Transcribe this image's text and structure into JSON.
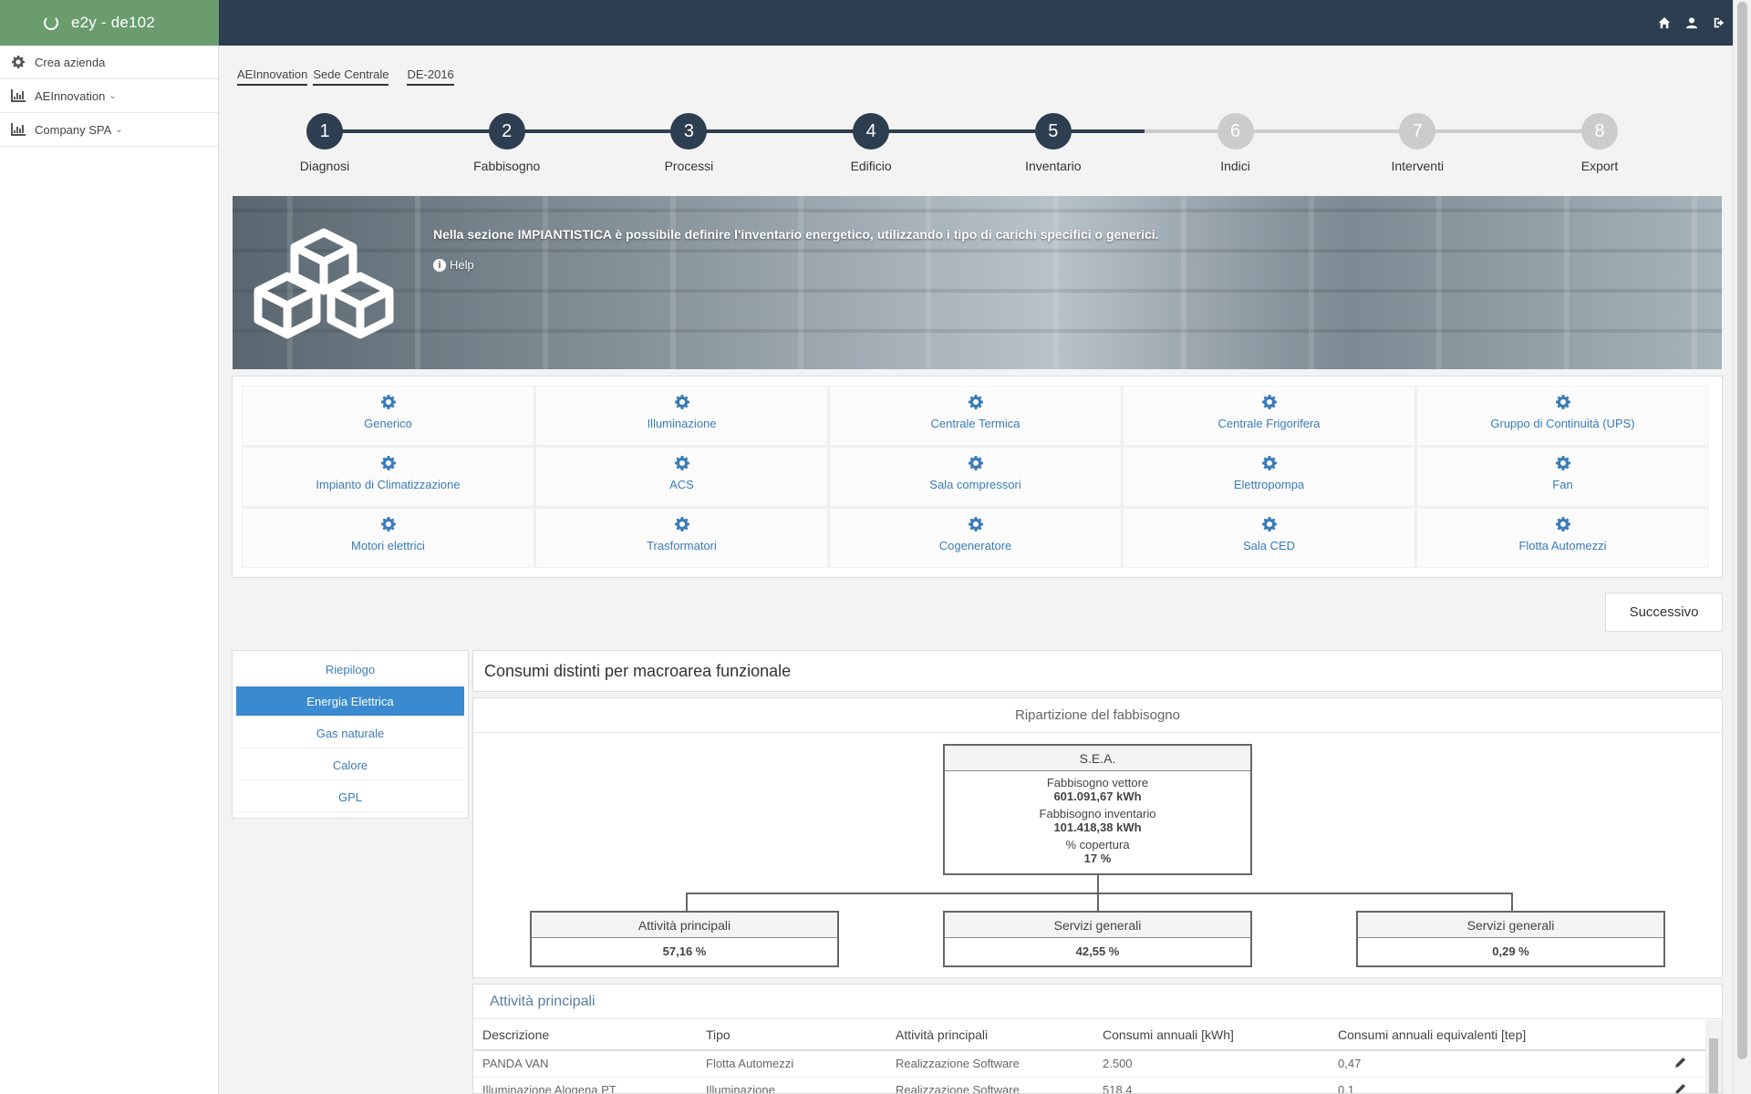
{
  "app": {
    "title": "e2y - de102"
  },
  "sidebar": {
    "items": [
      {
        "label": "Crea azienda",
        "icon": "gear-icon",
        "has_dropdown": false
      },
      {
        "label": "AEInnovation",
        "icon": "bar-chart-icon",
        "has_dropdown": true
      },
      {
        "label": "Company SPA",
        "icon": "bar-chart-icon",
        "has_dropdown": true
      }
    ]
  },
  "topbar": {
    "icons": [
      "home-icon",
      "user-icon",
      "logout-icon"
    ]
  },
  "breadcrumb": [
    "AEInnovation",
    "Sede Centrale",
    "DE-2016"
  ],
  "steps": [
    {
      "number": "1",
      "label": "Diagnosi",
      "done": true
    },
    {
      "number": "2",
      "label": "Fabbisogno",
      "done": true
    },
    {
      "number": "3",
      "label": "Processi",
      "done": true
    },
    {
      "number": "4",
      "label": "Edificio",
      "done": true
    },
    {
      "number": "5",
      "label": "Inventario",
      "done": true
    },
    {
      "number": "6",
      "label": "Indici",
      "done": false
    },
    {
      "number": "7",
      "label": "Interventi",
      "done": false
    },
    {
      "number": "8",
      "label": "Export",
      "done": false
    }
  ],
  "banner": {
    "message": "Nella sezione IMPIANTISTICA è possibile definire l'inventario energetico, utilizzando i tipo di carichi specifici o generici.",
    "help_label": "Help"
  },
  "categories": [
    "Generico",
    "Illuminazione",
    "Centrale Termica",
    "Centrale Frigorifera",
    "Gruppo di Continuità (UPS)",
    "Impianto di Climatizzazione",
    "ACS",
    "Sala compressori",
    "Elettropompa",
    "Fan",
    "Motori elettrici",
    "Trasformatori",
    "Cogeneratore",
    "Sala CED",
    "Flotta Automezzi"
  ],
  "next_button": "Successivo",
  "energy_tabs": [
    {
      "label": "Riepilogo",
      "active": false
    },
    {
      "label": "Energia Elettrica",
      "active": true
    },
    {
      "label": "Gas naturale",
      "active": false
    },
    {
      "label": "Calore",
      "active": false
    },
    {
      "label": "GPL",
      "active": false
    }
  ],
  "section_title": "Consumi distinti per macroarea funzionale",
  "tree": {
    "panel_title": "Ripartizione del fabbisogno",
    "root": {
      "title": "S.E.A.",
      "fabbisogno_vettore_label": "Fabbisogno vettore",
      "fabbisogno_vettore_value": "601.091,67 kWh",
      "fabbisogno_inventario_label": "Fabbisogno inventario",
      "fabbisogno_inventario_value": "101.418,38 kWh",
      "copertura_label": "% copertura",
      "copertura_value": "17 %"
    },
    "children": [
      {
        "title": "Attività principali",
        "value": "57,16 %"
      },
      {
        "title": "Servizi generali",
        "value": "42,55 %"
      },
      {
        "title": "Servizi generali",
        "value": "0,29 %"
      }
    ]
  },
  "table": {
    "title": "Attività principali",
    "columns": [
      "Descrizione",
      "Tipo",
      "Attività principali",
      "Consumi annuali [kWh]",
      "Consumi annuali equivalenti [tep]",
      ""
    ],
    "rows": [
      [
        "PANDA VAN",
        "Flotta Automezzi",
        "Realizzazione Software",
        "2.500",
        "0,47"
      ],
      [
        "Illuminazione Alogena PT",
        "Illuminazione",
        "Realizzazione Software",
        "518,4",
        "0,1"
      ]
    ]
  },
  "colors": {
    "brand_green": "#6a9c6e",
    "topbar": "#2c3e50",
    "step_done": "#2c3e50",
    "step_todo": "#cccccc",
    "accent_blue": "#3a8ad0",
    "link_blue": "#3a7cb8"
  }
}
